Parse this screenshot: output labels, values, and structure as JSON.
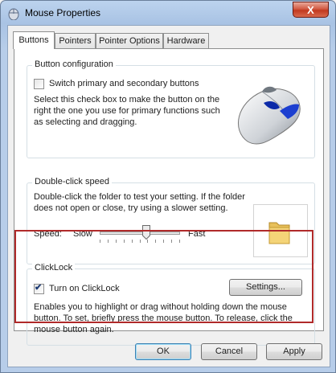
{
  "window": {
    "title": "Mouse Properties",
    "close_label": "X"
  },
  "tabs": [
    {
      "label": "Buttons"
    },
    {
      "label": "Pointers"
    },
    {
      "label": "Pointer Options"
    },
    {
      "label": "Hardware"
    }
  ],
  "button_configuration": {
    "heading": "Button configuration",
    "checkbox_label": "Switch primary and secondary buttons",
    "checked": false,
    "description": "Select this check box to make the button on the right the one you use for primary functions such as selecting and dragging."
  },
  "double_click_speed": {
    "heading": "Double-click speed",
    "description": "Double-click the folder to test your setting. If the folder does not open or close, try using a slower setting.",
    "speed_label": "Speed:",
    "slow_label": "Slow",
    "fast_label": "Fast",
    "slider_value_fraction": 0.58
  },
  "clicklock": {
    "heading": "ClickLock",
    "checkbox_label": "Turn on ClickLock",
    "checked": true,
    "settings_button": "Settings...",
    "description": "Enables you to highlight or drag without holding down the mouse button. To set, briefly press the mouse button. To release, click the mouse button again."
  },
  "buttons": {
    "ok": "OK",
    "cancel": "Cancel",
    "apply": "Apply"
  },
  "colors": {
    "highlight_box": "#b02a2a",
    "title_gradient": "#a9c3e4"
  }
}
